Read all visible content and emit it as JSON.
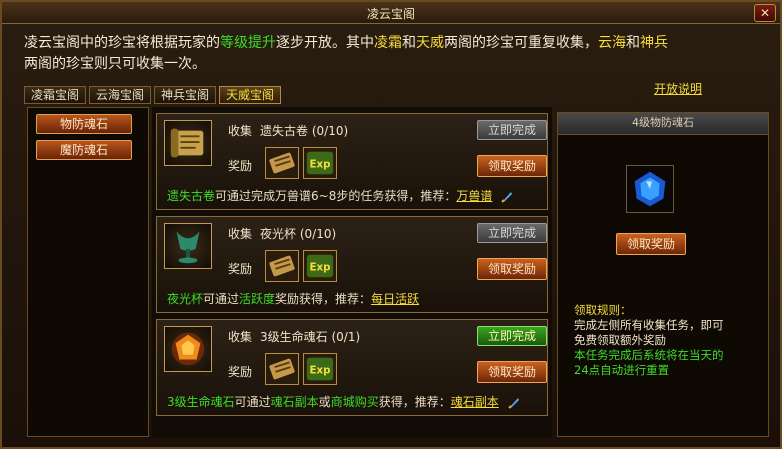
{
  "window": {
    "title": "凌云宝阁",
    "close_label": "✕"
  },
  "intro": {
    "p1": "凌云宝阁中的珍宝将根据玩家的",
    "h1": "等级提升",
    "p2": "逐步开放。其中",
    "h2": "凌霜",
    "p3": "和",
    "h3": "天威",
    "p4": "两阁的珍宝可重复收集，",
    "h4": "云海",
    "p5": "和",
    "h5": "神兵",
    "p6": "两阁的珍宝则只可收集一次。"
  },
  "tabs": [
    "凌霜宝阁",
    "云海宝阁",
    "神兵宝阁",
    "天威宝阁"
  ],
  "open_link": "开放说明",
  "categories": [
    "物防魂石",
    "魔防魂石"
  ],
  "tasks": [
    {
      "prefix": "收集",
      "name": "遗失古卷",
      "progress": "(0/10)",
      "reward_label": "奖励",
      "complete_label": "立即完成",
      "claim_label": "领取奖励",
      "desc_item": "遗失古卷",
      "desc_text": "可通过完成万兽谱6~8步的任务获得，推荐：",
      "desc_link": "万兽谱"
    },
    {
      "prefix": "收集",
      "name": "夜光杯",
      "progress": "(0/10)",
      "reward_label": "奖励",
      "complete_label": "立即完成",
      "claim_label": "领取奖励",
      "desc_item": "夜光杯",
      "desc_text_a": "可通过",
      "desc_hl": "活跃度",
      "desc_text_b": "奖励获得，推荐：",
      "desc_link": "每日活跃"
    },
    {
      "prefix": "收集",
      "name": "3级生命魂石",
      "progress": "(0/1)",
      "reward_label": "奖励",
      "complete_label": "立即完成",
      "claim_label": "领取奖励",
      "desc_item": "3级生命魂石",
      "desc_text_a": "可通过",
      "desc_hl1": "魂石副本",
      "desc_text_b": "或",
      "desc_hl2": "商城购买",
      "desc_text_c": "获得，推荐：",
      "desc_link": "魂石副本"
    }
  ],
  "right_panel": {
    "title": "4级物防魂石",
    "claim_label": "领取奖励",
    "rules_head": "领取规则：",
    "rules_line1": "完成左侧所有收集任务，即可",
    "rules_line2": "免费领取额外奖励",
    "rules_line3": "本任务完成后系统将在当天的",
    "rules_line4": "24点自动进行重置"
  },
  "reward_icons": [
    "scroll-icon",
    "exp-icon"
  ],
  "colors": {
    "accent_green": "#3ddc2a",
    "accent_yellow": "#f6dd3a",
    "button_orange": "#c9611f",
    "button_green": "#3aa421"
  }
}
